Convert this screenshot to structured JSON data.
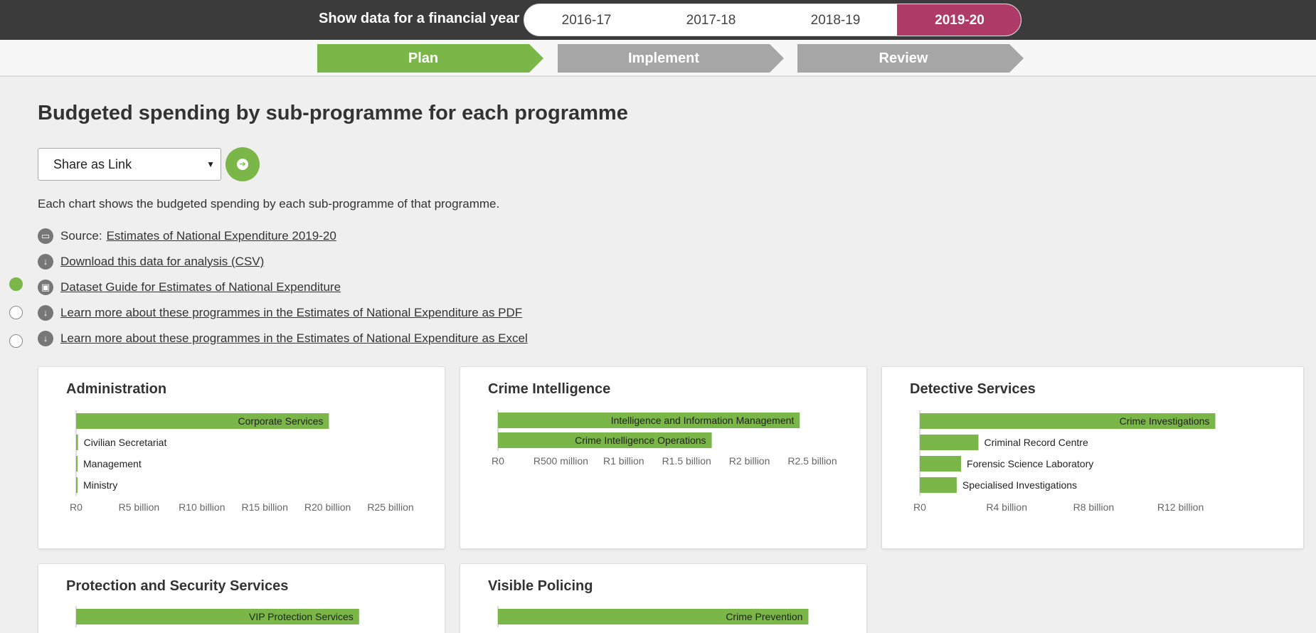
{
  "header": {
    "label": "Show data for a financial year",
    "years": [
      {
        "label": "2016-17",
        "active": false
      },
      {
        "label": "2017-18",
        "active": false
      },
      {
        "label": "2018-19",
        "active": false
      },
      {
        "label": "2019-20",
        "active": true
      }
    ]
  },
  "steps": [
    {
      "label": "Plan",
      "active": true
    },
    {
      "label": "Implement",
      "active": false
    },
    {
      "label": "Review",
      "active": false
    }
  ],
  "main": {
    "title": "Budgeted spending by sub-programme for each programme",
    "share_select_value": "Share as Link",
    "description": "Each chart shows the budgeted spending by each sub-programme of that programme.",
    "source_prefix": "Source:",
    "links": [
      {
        "prefix": "Source:",
        "text": "Estimates of National Expenditure 2019-20",
        "icon": "folder-icon"
      },
      {
        "prefix": "",
        "text": "Download this data for analysis (CSV)",
        "icon": "download-icon"
      },
      {
        "prefix": "",
        "text": "Dataset Guide for Estimates of National Expenditure",
        "icon": "guide-icon"
      },
      {
        "prefix": "",
        "text": "Learn more about these programmes in the Estimates of National Expenditure as PDF",
        "icon": "download-icon"
      },
      {
        "prefix": "",
        "text": "Learn more about these programmes in the Estimates of National Expenditure as Excel",
        "icon": "download-icon"
      }
    ],
    "radios": [
      true,
      false,
      false
    ]
  },
  "colors": {
    "accent_green": "#7ab648",
    "active_year": "#ad3a67",
    "inactive_step": "#a6a6a6",
    "topbar": "#3b3b3b"
  },
  "chart_data": [
    {
      "type": "bar",
      "title": "Administration",
      "categories": [
        "Corporate Services",
        "Civilian Secretariat",
        "Management",
        "Ministry"
      ],
      "values": [
        20.1,
        0.15,
        0.09,
        0.07
      ],
      "units": "R billion",
      "ticks": [
        0,
        5,
        10,
        15,
        20,
        25
      ],
      "tick_labels": [
        "R0",
        "R5 billion",
        "R10 billion",
        "R15 billion",
        "R20 billion",
        "R25 billion"
      ],
      "xlim": [
        0,
        25
      ]
    },
    {
      "type": "bar",
      "title": "Crime Intelligence",
      "categories": [
        "Intelligence and Information Management",
        "Crime Intelligence Operations"
      ],
      "values": [
        2.4,
        1.7
      ],
      "units": "R billion",
      "ticks": [
        0,
        0.5,
        1,
        1.5,
        2,
        2.5
      ],
      "tick_labels": [
        "R0",
        "R500 million",
        "R1 billion",
        "R1.5 billion",
        "R2 billion",
        "R2.5 billion"
      ],
      "xlim": [
        0,
        2.5
      ]
    },
    {
      "type": "bar",
      "title": "Detective Services",
      "categories": [
        "Crime Investigations",
        "Criminal Record Centre",
        "Forensic Science Laboratory",
        "Specialised Investigations"
      ],
      "values": [
        13.6,
        2.7,
        1.9,
        1.7
      ],
      "units": "R billion",
      "ticks": [
        0,
        4,
        8,
        12
      ],
      "tick_labels": [
        "R0",
        "R4 billion",
        "R8 billion",
        "R12 billion"
      ],
      "xlim": [
        0,
        14.6
      ]
    },
    {
      "type": "bar",
      "title": "Protection and Security Services",
      "categories": [
        "VIP Protection Services"
      ],
      "values": [
        1.8
      ],
      "units": "R billion",
      "ticks": [],
      "tick_labels": [],
      "xlim": [
        0,
        2
      ]
    },
    {
      "type": "bar",
      "title": "Visible Policing",
      "categories": [
        "Crime Prevention"
      ],
      "values": [
        39.5
      ],
      "units": "R billion",
      "ticks": [],
      "tick_labels": [],
      "xlim": [
        0,
        40
      ]
    }
  ]
}
